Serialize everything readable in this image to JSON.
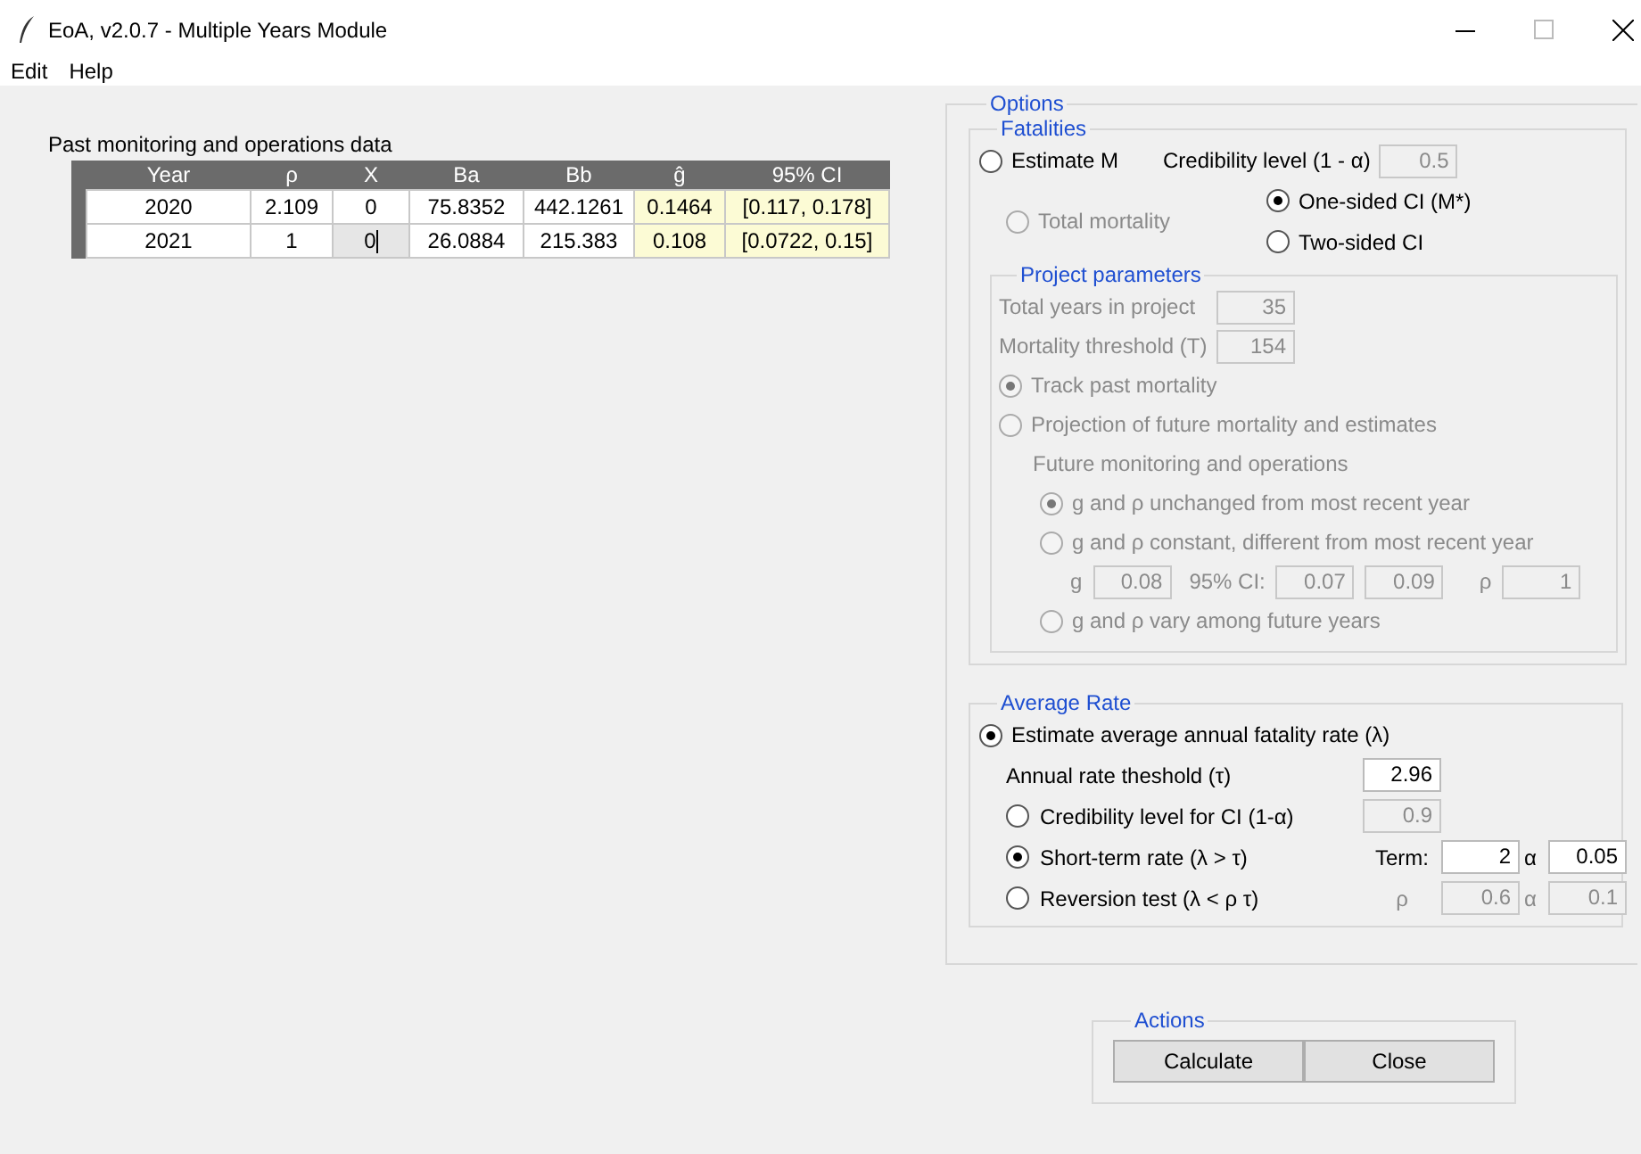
{
  "window": {
    "title": "EoA, v2.0.7 - Multiple Years Module"
  },
  "menu": [
    "Edit",
    "Help"
  ],
  "past_data": {
    "label": "Past monitoring and operations data",
    "columns": [
      "Year",
      "ρ",
      "X",
      "Ba",
      "Bb",
      "ĝ",
      "95% CI"
    ],
    "rows": [
      {
        "cells": [
          {
            "text": "2020",
            "kind": "input"
          },
          {
            "text": "2.109",
            "kind": "input"
          },
          {
            "text": "0",
            "kind": "input"
          },
          {
            "text": "75.8352",
            "kind": "input"
          },
          {
            "text": "442.1261",
            "kind": "input"
          },
          {
            "text": "0.1464",
            "kind": "output"
          },
          {
            "text": "[0.117, 0.178]",
            "kind": "output"
          }
        ]
      },
      {
        "cells": [
          {
            "text": "2021",
            "kind": "input"
          },
          {
            "text": "1",
            "kind": "input"
          },
          {
            "text": "0",
            "kind": "focused"
          },
          {
            "text": "26.0884",
            "kind": "input"
          },
          {
            "text": "215.383",
            "kind": "input"
          },
          {
            "text": "0.108",
            "kind": "output"
          },
          {
            "text": "[0.0722, 0.15]",
            "kind": "output"
          }
        ]
      }
    ]
  },
  "options": {
    "title": "Options",
    "fatalities": {
      "title": "Fatalities",
      "estimate_m": {
        "label": "Estimate M",
        "selected": false
      },
      "credibility": {
        "label": "Credibility level (1 - α)",
        "value": "0.5",
        "disabled": true
      },
      "total_mortality": {
        "label": "Total mortality",
        "selected": false,
        "disabled": true
      },
      "ci_options": [
        {
          "label": "One-sided CI (M*)",
          "selected": true,
          "disabled": false
        },
        {
          "label": "Two-sided CI",
          "selected": false,
          "disabled": false
        }
      ],
      "project": {
        "title": "Project parameters",
        "disabled": true,
        "fields": [
          {
            "label": "Total years in project",
            "value": "35"
          },
          {
            "label": "Mortality threshold (T)",
            "value": "154"
          }
        ],
        "modes": [
          {
            "label": "Track past mortality",
            "selected": true
          },
          {
            "label": "Projection of future mortality and estimates",
            "selected": false
          }
        ],
        "future": {
          "title": "Future monitoring and operations",
          "choices": [
            {
              "label": "g and ρ unchanged from most recent year",
              "selected": true
            },
            {
              "label": "g and ρ constant, different from most recent year",
              "selected": false
            },
            {
              "label": "g and ρ vary among future years",
              "selected": false
            }
          ],
          "constant": {
            "g_label": "g",
            "g": "0.08",
            "ci_label": "95% CI:",
            "ci_low": "0.07",
            "ci_high": "0.09",
            "rho_label": "ρ",
            "rho": "1"
          }
        }
      }
    },
    "average_rate": {
      "title": "Average Rate",
      "estimate": {
        "label": "Estimate average annual fatality rate (λ)",
        "selected": true
      },
      "threshold": {
        "label": "Annual rate theshold (τ)",
        "value": "2.96"
      },
      "tests": [
        {
          "label": "Credibility level for CI (1-α)",
          "selected": false,
          "params": [
            {
              "value": "0.9"
            }
          ]
        },
        {
          "label": "Short-term rate (λ > τ)",
          "selected": true,
          "params": [
            {
              "label": "Term:",
              "value": "2"
            },
            {
              "label": "α",
              "value": "0.05"
            }
          ]
        },
        {
          "label": "Reversion test (λ < ρ τ)",
          "selected": false,
          "params": [
            {
              "label": "ρ",
              "value": "0.6"
            },
            {
              "label": "α",
              "value": "0.1"
            }
          ]
        }
      ]
    }
  },
  "actions": {
    "title": "Actions",
    "buttons": [
      "Calculate",
      "Close"
    ]
  }
}
